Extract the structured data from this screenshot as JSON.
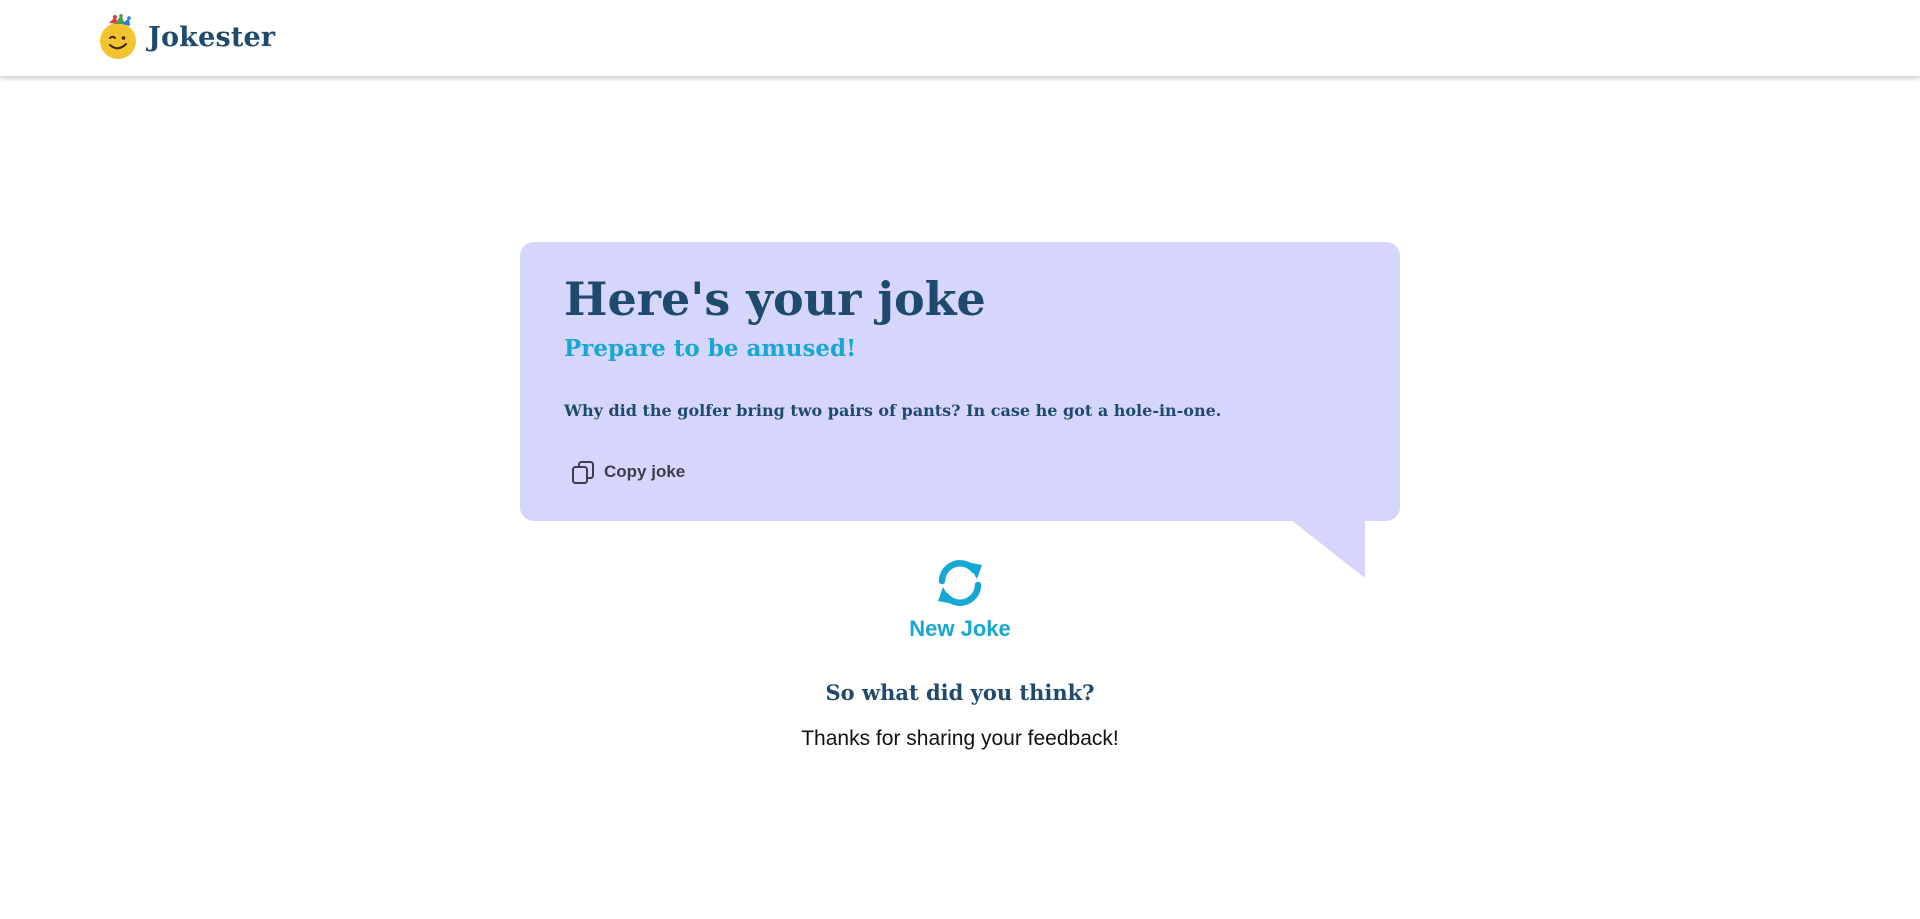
{
  "header": {
    "brand_name": "Jokester",
    "logo_icon": "jester-smiley-logo-icon"
  },
  "joke_card": {
    "title": "Here's your joke",
    "subtitle": "Prepare to be amused!",
    "joke": "Why did the golfer bring two pairs of pants? In case he got a hole-in-one.",
    "copy_label": "Copy joke",
    "copy_icon": "copy-icon"
  },
  "new_joke": {
    "label": "New Joke",
    "icon": "refresh-icon"
  },
  "feedback": {
    "heading": "So what did you think?",
    "message": "Thanks for sharing your feedback!"
  },
  "colors": {
    "primary_text": "#1f4a6e",
    "accent": "#17a7d5",
    "card_background": "#d6d5fb",
    "logo_yellow": "#f4c430"
  }
}
